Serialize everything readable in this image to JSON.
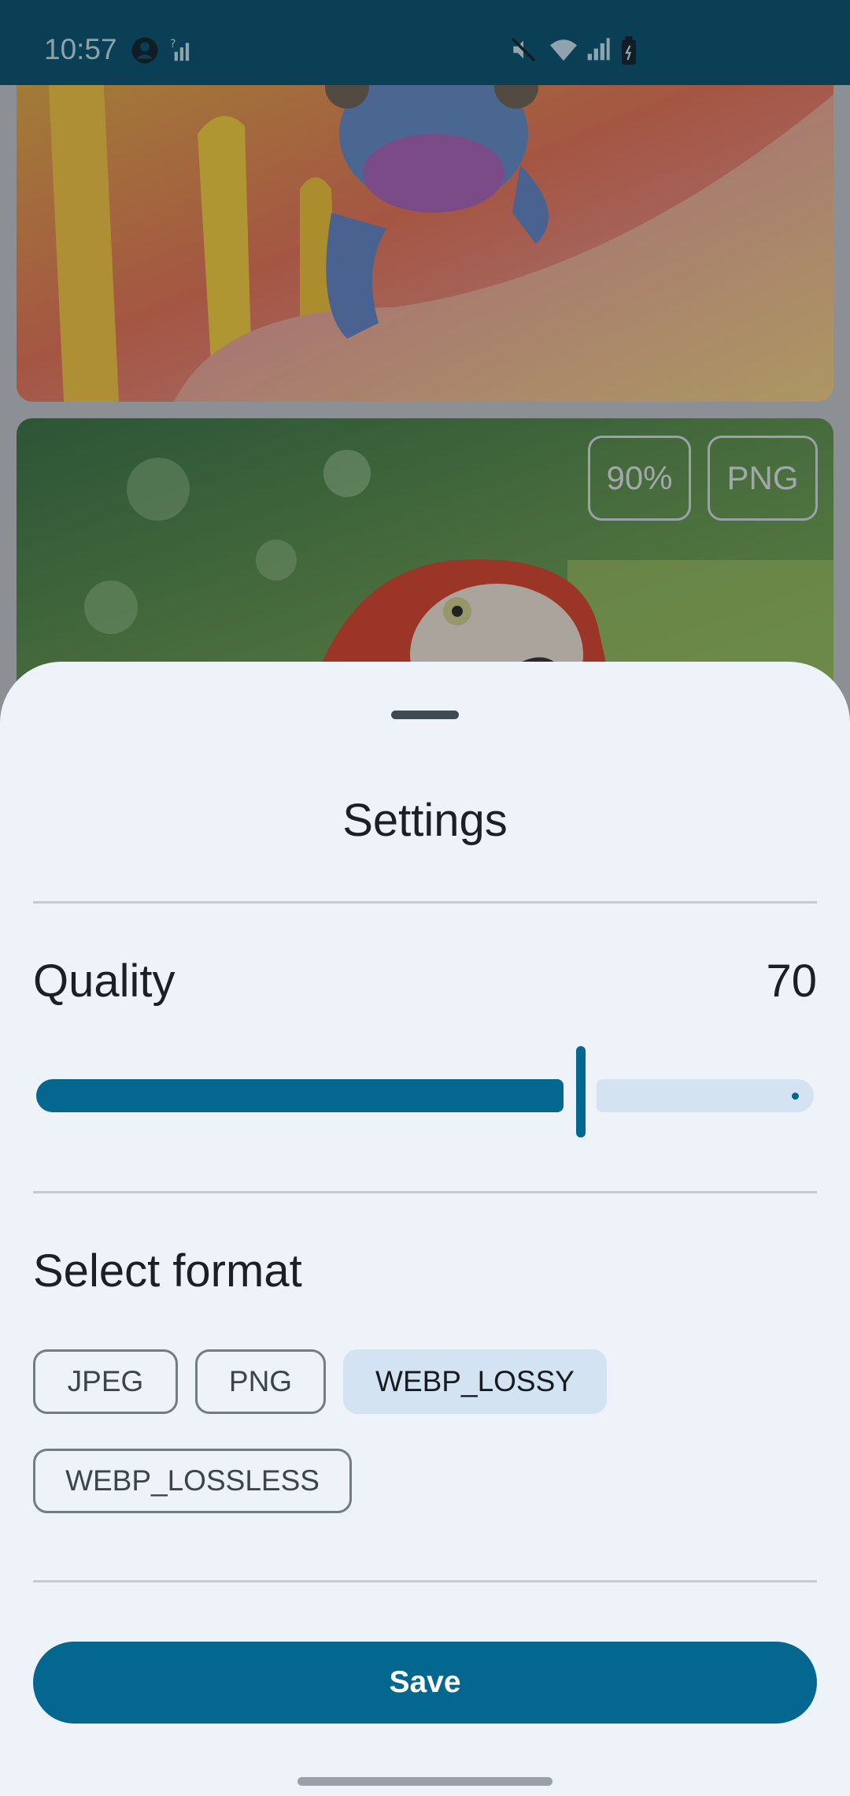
{
  "status_bar": {
    "time": "10:57",
    "icons": [
      "account-circle-icon",
      "no-signal-icon",
      "mute-icon",
      "wifi-icon",
      "signal-icon",
      "battery-icon"
    ]
  },
  "gallery": {
    "cards": [
      {
        "subject": "chameleon-image"
      },
      {
        "subject": "parrot-image",
        "quality_badge": "90%",
        "format_badge": "PNG"
      }
    ]
  },
  "sheet": {
    "title": "Settings",
    "quality": {
      "label": "Quality",
      "value": "70",
      "slider_fraction": 0.7
    },
    "format": {
      "label": "Select format",
      "options": [
        "JPEG",
        "PNG",
        "WEBP_LOSSY",
        "WEBP_LOSSLESS"
      ],
      "selected": "WEBP_LOSSY"
    },
    "save_label": "Save"
  },
  "colors": {
    "primary": "#04678f",
    "status_bar": "#0a3f56",
    "sheet_bg": "#eef2f9",
    "chip_selected": "#d3e3f1"
  }
}
